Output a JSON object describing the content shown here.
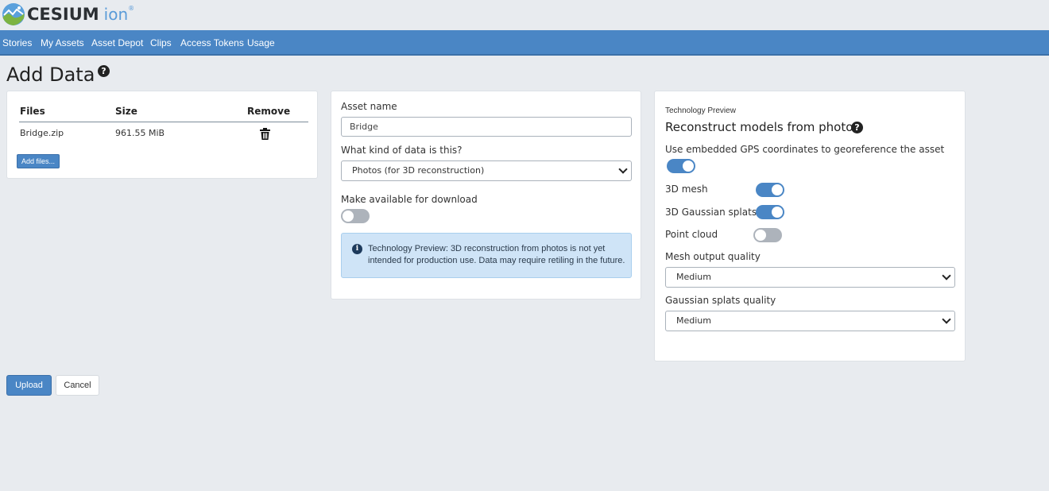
{
  "header": {
    "logo_text": "CESIUM",
    "logo_ion": "ion",
    "logo_tm": "®"
  },
  "nav": {
    "items": [
      "Stories",
      "My Assets",
      "Asset Depot",
      "Clips",
      "Access Tokens",
      "Usage"
    ]
  },
  "page": {
    "title": "Add Data",
    "help_glyph": "?"
  },
  "files": {
    "headers": {
      "files": "Files",
      "size": "Size",
      "remove": "Remove"
    },
    "rows": [
      {
        "name": "Bridge.zip",
        "size": "961.55 MiB",
        "remove_icon": "trash-icon"
      }
    ],
    "add_button": "Add files..."
  },
  "asset": {
    "name_label": "Asset name",
    "name_value": "Bridge",
    "kind_label": "What kind of data is this?",
    "kind_value": "Photos (for 3D reconstruction)",
    "download_label": "Make available for download",
    "download_enabled": false,
    "notice_icon": "info-icon",
    "notice": "Technology Preview: 3D reconstruction from photos is not yet intended for production use. Data may require retiling in the future."
  },
  "reconstruct": {
    "caption": "Technology Preview",
    "title": "Reconstruct models from photos",
    "gps_label": "Use embedded GPS coordinates to georeference the asset",
    "gps_enabled": true,
    "mesh_label": "3D mesh",
    "mesh_enabled": true,
    "splats_label": "3D Gaussian splats",
    "splats_enabled": true,
    "pointcloud_label": "Point cloud",
    "pointcloud_enabled": false,
    "mesh_quality_label": "Mesh output quality",
    "mesh_quality_value": "Medium",
    "splats_quality_label": "Gaussian splats quality",
    "splats_quality_value": "Medium"
  },
  "actions": {
    "upload": "Upload",
    "cancel": "Cancel"
  },
  "colors": {
    "brand": "#4a86c5",
    "page_bg": "#e8ebef",
    "notice_bg": "#cfe4f7"
  }
}
